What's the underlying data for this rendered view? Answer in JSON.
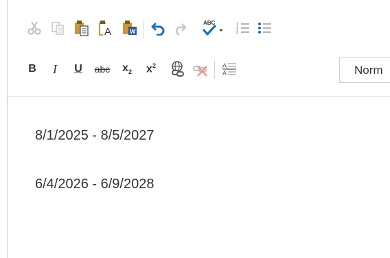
{
  "toolbar": {
    "row1": [
      {
        "name": "cut-icon"
      },
      {
        "name": "copy-icon"
      },
      {
        "name": "paste-icon"
      },
      {
        "name": "paste-as-text-icon"
      },
      {
        "name": "paste-from-word-icon"
      },
      {
        "name": "undo-icon"
      },
      {
        "name": "redo-icon"
      },
      {
        "name": "spellcheck-icon"
      },
      {
        "name": "numbered-list-icon"
      },
      {
        "name": "bulleted-list-icon"
      }
    ],
    "row2": {
      "bold": "B",
      "italic": "I",
      "underline": "U",
      "strike": "abc",
      "subscript_base": "x",
      "subscript_sub": "2",
      "superscript_base": "x",
      "superscript_sup": "2",
      "link_icon": "link-icon",
      "unlink_icon": "unlink-icon",
      "remove_format_icon": "remove-format-icon"
    },
    "style_select": "Norm",
    "spell_label": "ABC",
    "paste_text_label": "A",
    "paste_word_label": "W",
    "accent": "#1f6fb5"
  },
  "content": {
    "paragraphs": [
      "8/1/2025 - 8/5/2027",
      "6/4/2026 - 6/9/2028"
    ]
  }
}
